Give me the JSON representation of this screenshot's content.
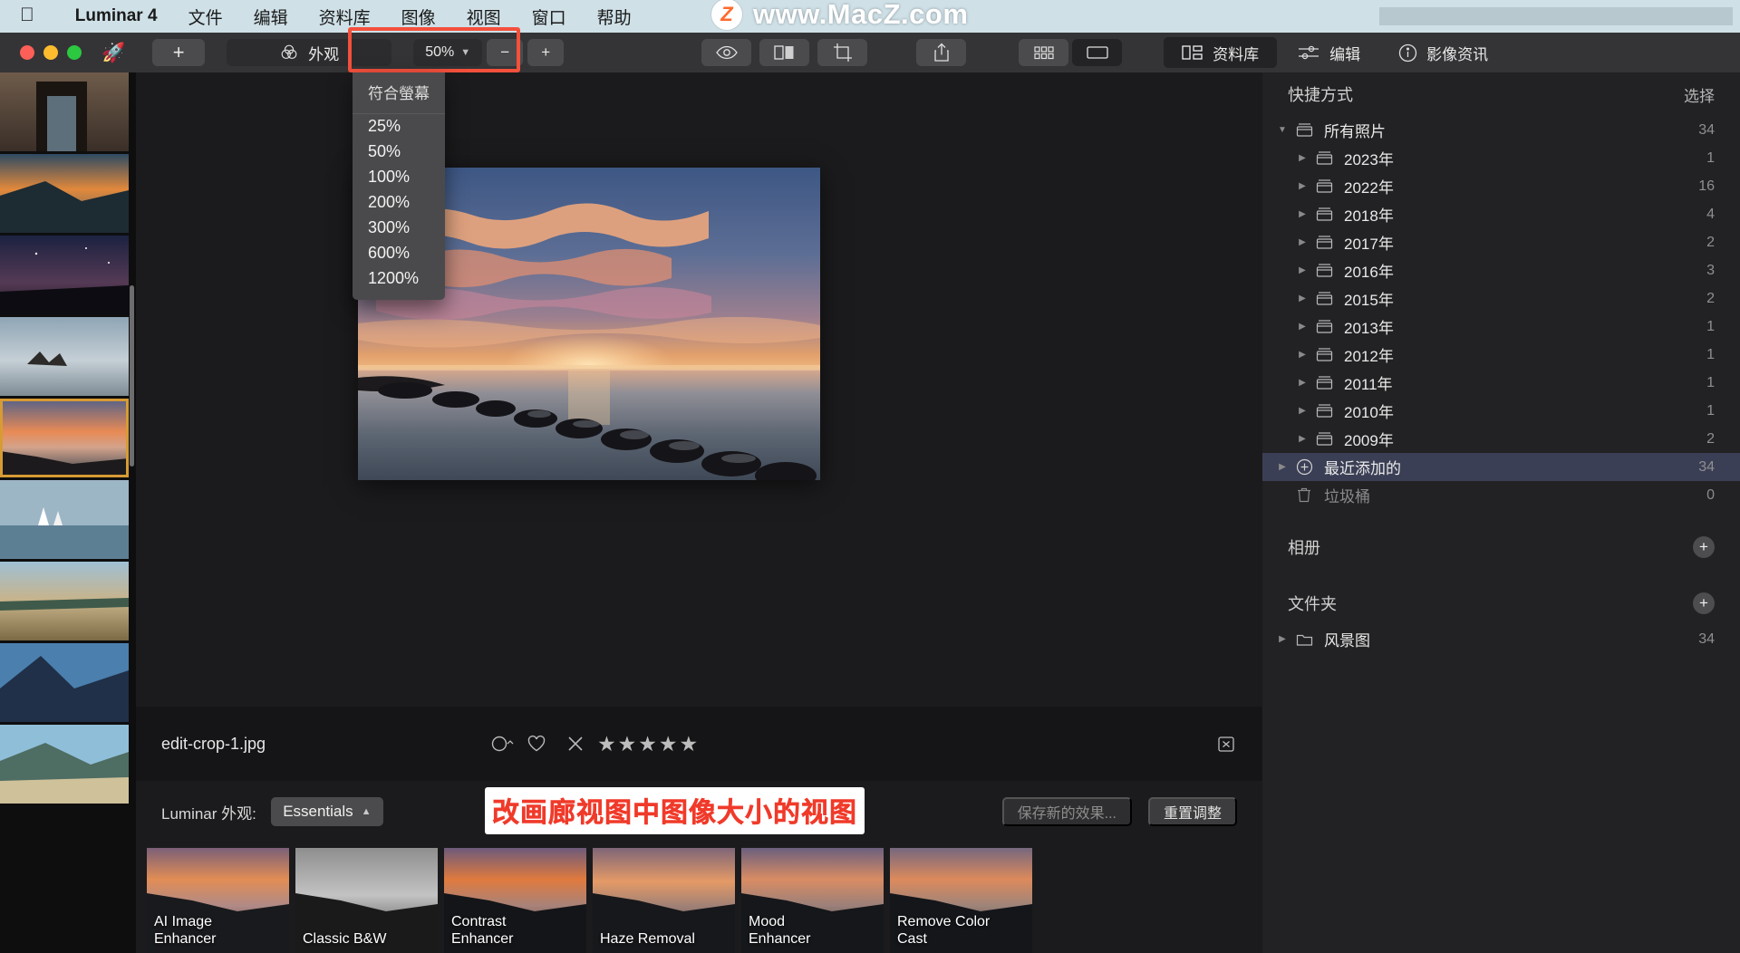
{
  "menubar": {
    "apple_icon": "apple-logo",
    "items": [
      "Luminar 4",
      "文件",
      "编辑",
      "资料库",
      "图像",
      "视图",
      "窗口",
      "帮助"
    ]
  },
  "watermark": {
    "badge": "Z",
    "text": "www.MacZ.com"
  },
  "toolbar": {
    "add_label": "+",
    "look_label": "外观",
    "zoom_value": "50%",
    "zoom_out": "−",
    "zoom_in": "+",
    "preview_icon": "eye-icon",
    "compare_icon": "compare-split-icon",
    "crop_icon": "crop-icon",
    "share_icon": "share-icon",
    "grid_view_icon": "grid-view-icon",
    "single_view_icon": "single-view-icon",
    "library_tab": "资料库",
    "edit_tab": "编辑",
    "info_tab": "影像资讯"
  },
  "zoom_menu": {
    "header": "符合螢幕",
    "items": [
      "25%",
      "50%",
      "100%",
      "200%",
      "300%",
      "600%",
      "1200%"
    ]
  },
  "infobar": {
    "filename": "edit-crop-1.jpg",
    "color_label_icon": "color-label-icon",
    "favorite_icon": "heart-icon",
    "reject_icon": "reject-x-icon",
    "stars": "★★★★★",
    "trash_icon": "trash-icon"
  },
  "looksbar": {
    "label": "Luminar 外观:",
    "category": "Essentials",
    "save_label": "保存新的效果...",
    "reset_label": "重置调整"
  },
  "annotation": {
    "text": "改画廊视图中图像大小的视图"
  },
  "presets": [
    {
      "name": "AI Image\nEnhancer",
      "line1": "AI Image",
      "line2": "Enhancer"
    },
    {
      "name": "Classic B&W",
      "line1": "Classic B&W",
      "line2": ""
    },
    {
      "name": "Contrast Enhancer",
      "line1": "Contrast",
      "line2": "Enhancer"
    },
    {
      "name": "Haze Removal",
      "line1": "Haze Removal",
      "line2": ""
    },
    {
      "name": "Mood Enhancer",
      "line1": "Mood",
      "line2": "Enhancer"
    },
    {
      "name": "Remove Color Cast",
      "line1": "Remove Color",
      "line2": "Cast"
    }
  ],
  "sidebar": {
    "shortcuts_title": "快捷方式",
    "shortcuts_action": "选择",
    "tree": [
      {
        "label": "所有照片",
        "count": "34",
        "level": 0,
        "expanded": true,
        "icon": "album-icon",
        "selected": false
      },
      {
        "label": "2023年",
        "count": "1",
        "level": 1,
        "expanded": false,
        "icon": "album-icon",
        "selected": false
      },
      {
        "label": "2022年",
        "count": "16",
        "level": 1,
        "expanded": false,
        "icon": "album-icon",
        "selected": false
      },
      {
        "label": "2018年",
        "count": "4",
        "level": 1,
        "expanded": false,
        "icon": "album-icon",
        "selected": false
      },
      {
        "label": "2017年",
        "count": "2",
        "level": 1,
        "expanded": false,
        "icon": "album-icon",
        "selected": false
      },
      {
        "label": "2016年",
        "count": "3",
        "level": 1,
        "expanded": false,
        "icon": "album-icon",
        "selected": false
      },
      {
        "label": "2015年",
        "count": "2",
        "level": 1,
        "expanded": false,
        "icon": "album-icon",
        "selected": false
      },
      {
        "label": "2013年",
        "count": "1",
        "level": 1,
        "expanded": false,
        "icon": "album-icon",
        "selected": false
      },
      {
        "label": "2012年",
        "count": "1",
        "level": 1,
        "expanded": false,
        "icon": "album-icon",
        "selected": false
      },
      {
        "label": "2011年",
        "count": "1",
        "level": 1,
        "expanded": false,
        "icon": "album-icon",
        "selected": false
      },
      {
        "label": "2010年",
        "count": "1",
        "level": 1,
        "expanded": false,
        "icon": "album-icon",
        "selected": false
      },
      {
        "label": "2009年",
        "count": "2",
        "level": 1,
        "expanded": false,
        "icon": "album-icon",
        "selected": false
      },
      {
        "label": "最近添加的",
        "count": "34",
        "level": 0,
        "expanded": false,
        "icon": "plus-circle-icon",
        "selected": true
      },
      {
        "label": "垃圾桶",
        "count": "0",
        "level": 0,
        "expanded": null,
        "icon": "trash-icon",
        "selected": false,
        "dim": true
      }
    ],
    "albums_title": "相册",
    "folders_title": "文件夹",
    "folders": [
      {
        "label": "风景图",
        "count": "34",
        "icon": "folder-icon"
      }
    ]
  },
  "colors": {
    "menubar_bg": "#cfe0e7",
    "toolbar_bg": "#343436",
    "canvas_bg": "#1b1b1d",
    "sidebar_bg": "#222224",
    "selection_blue": "#3b3f55",
    "highlight_red": "#f4503c",
    "thumb_selected": "#d79b34"
  }
}
